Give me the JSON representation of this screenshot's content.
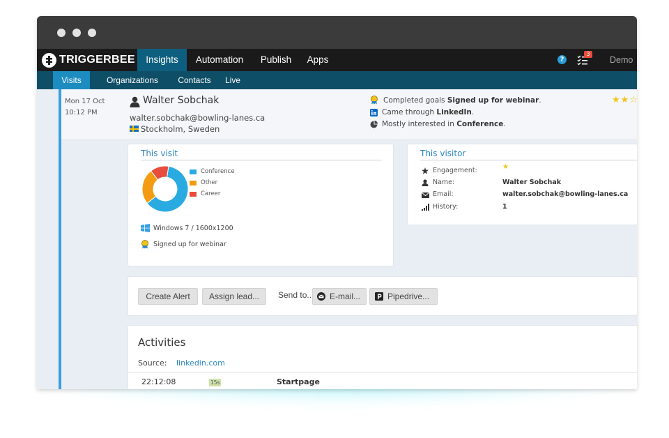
{
  "window": {
    "controls": [
      "close",
      "minimize",
      "maximize"
    ]
  },
  "brand": {
    "name": "TRIGGERBEE",
    "logo_icon": "triggerbee-logo-icon"
  },
  "top_nav": {
    "tabs": [
      {
        "label": "Insights",
        "active": true
      },
      {
        "label": "Automation",
        "active": false
      },
      {
        "label": "Publish",
        "active": false
      },
      {
        "label": "Apps",
        "active": false
      }
    ],
    "help_icon_glyph": "?",
    "tasks_count": "3",
    "user": "Demo"
  },
  "sub_nav": {
    "tabs": [
      {
        "label": "Visits",
        "active": true
      },
      {
        "label": "Organizations",
        "active": false
      },
      {
        "label": "Contacts",
        "active": false
      },
      {
        "label": "Live",
        "active": false
      }
    ]
  },
  "visit": {
    "date": "Mon 17 Oct",
    "time": "10:12 PM",
    "name": "Walter Sobchak",
    "email": "walter.sobchak@bowling-lanes.ca",
    "location": "Stockholm, Sweden",
    "summary": [
      {
        "icon": "goal-medal-icon",
        "prefix": "Completed goals ",
        "bold": "Signed up for webinar",
        "suffix": "."
      },
      {
        "icon": "linkedin-icon",
        "prefix": "Came through ",
        "bold": "LinkedIn",
        "suffix": "."
      },
      {
        "icon": "pie-icon",
        "prefix": "Mostly interested in ",
        "bold": "Conference",
        "suffix": "."
      }
    ],
    "rating_stars": "★★☆"
  },
  "this_visit": {
    "title": "This visit",
    "legend": [
      {
        "label": "Conference",
        "color": "#29abe2"
      },
      {
        "label": "Other",
        "color": "#f39c12"
      },
      {
        "label": "Career",
        "color": "#e74c3c"
      }
    ],
    "os": "Windows 7 / 1600x1200",
    "goal": "Signed up for webinar"
  },
  "chart_data": {
    "type": "pie",
    "categories": [
      "Conference",
      "Other",
      "Career"
    ],
    "values": [
      62,
      25,
      13
    ],
    "colors": [
      "#29abe2",
      "#f39c12",
      "#e74c3c"
    ],
    "donut": true,
    "legend": "right"
  },
  "this_visitor": {
    "title": "This visitor",
    "rows": [
      {
        "icon": "star-icon",
        "label": "Engagement:",
        "value": "★"
      },
      {
        "icon": "person-icon",
        "label": "Name:",
        "value": "Walter Sobchak"
      },
      {
        "icon": "envelope-icon",
        "label": "Email:",
        "value": "walter.sobchak@bowling-lanes.ca"
      },
      {
        "icon": "signal-bars-icon",
        "label": "History:",
        "value": "1"
      }
    ]
  },
  "actions": {
    "create_alert": "Create Alert",
    "assign_lead": "Assign lead...",
    "send_to": "Send to...",
    "email": "E-mail...",
    "pipedrive": "Pipedrive..."
  },
  "activities": {
    "title": "Activities",
    "source_label": "Source:",
    "source_value": "linkedin.com",
    "rows": [
      {
        "time": "22:12:08",
        "duration": "15s",
        "page": "Startpage"
      }
    ]
  }
}
